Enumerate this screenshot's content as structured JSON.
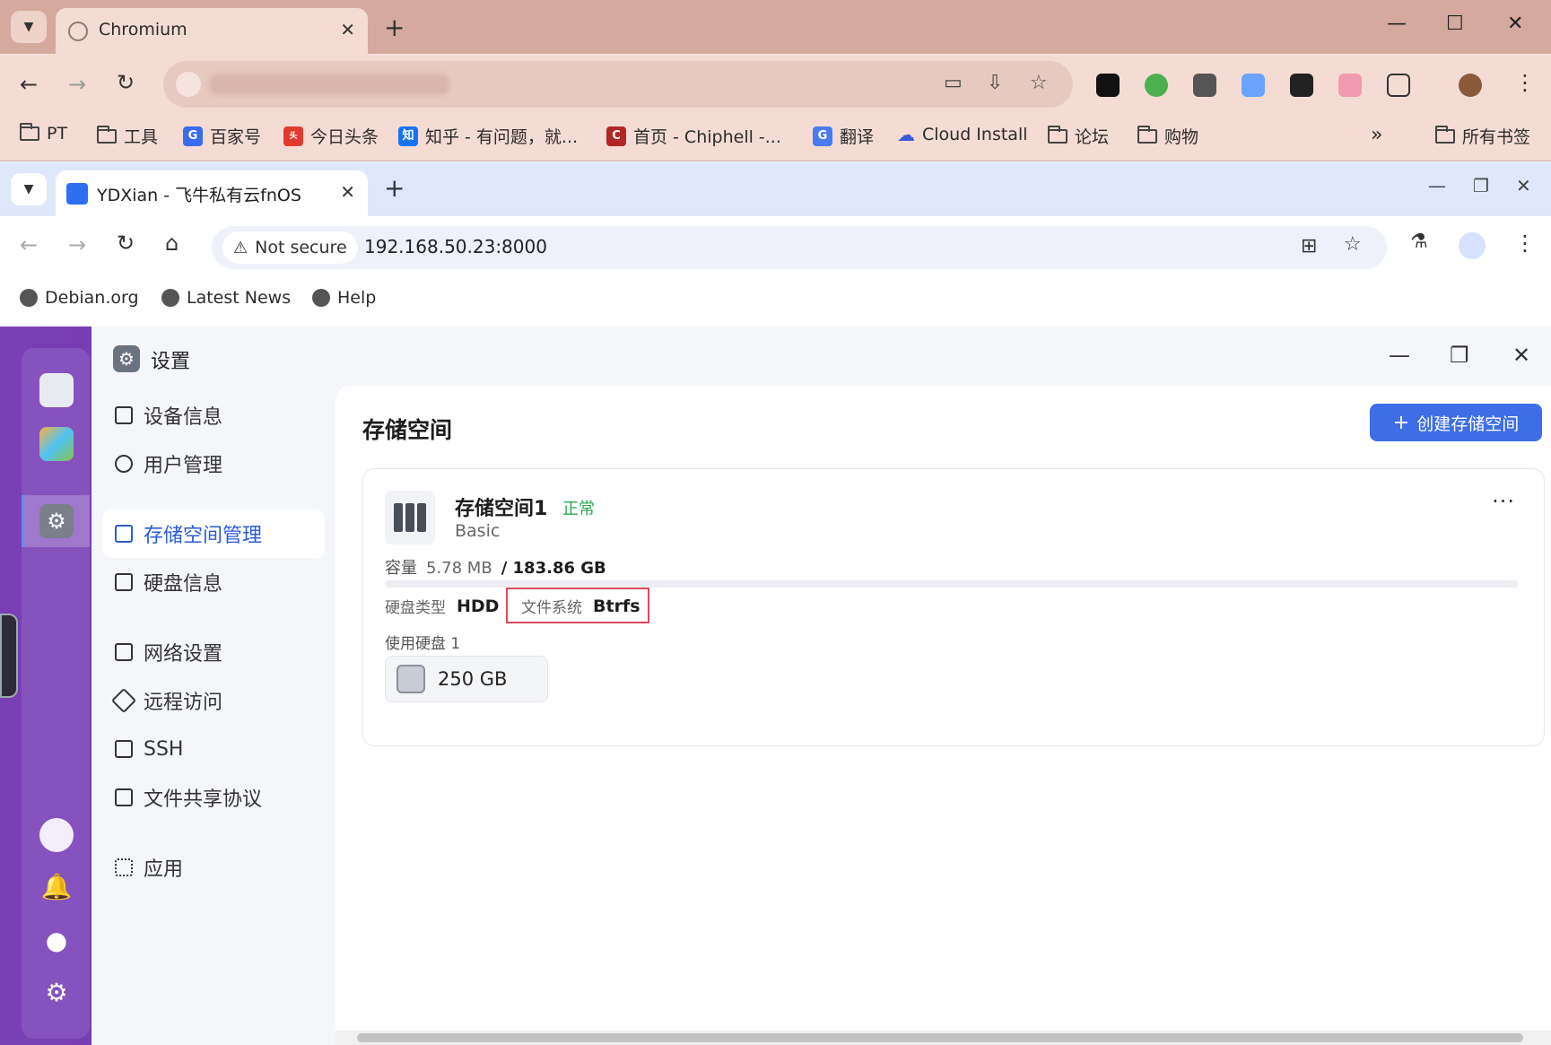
{
  "outer_browser": {
    "tab_title": "Chromium",
    "new_tab": "+",
    "close": "✕",
    "bookmarks": [
      {
        "label": "PT",
        "icon": "folder-icon"
      },
      {
        "label": "工具",
        "icon": "folder-icon"
      },
      {
        "label": "百家号",
        "icon": "baijiahao-icon"
      },
      {
        "label": "今日头条",
        "icon": "toutiao-icon"
      },
      {
        "label": "知乎 - 有问题，就...",
        "icon": "zhihu-icon"
      },
      {
        "label": "首页 - Chiphell -...",
        "icon": "chiphell-icon"
      },
      {
        "label": "翻译",
        "icon": "translate-icon"
      },
      {
        "label": "Cloud Install",
        "icon": "cloud-icon"
      },
      {
        "label": "论坛",
        "icon": "folder-icon"
      },
      {
        "label": "购物",
        "icon": "folder-icon"
      }
    ],
    "overflow": "»",
    "all_bookmarks": "所有书签"
  },
  "inner_browser": {
    "tab_title": "YDXian - 飞牛私有云fnOS",
    "new_tab": "+",
    "close": "✕",
    "security_label": "Not secure",
    "url": "192.168.50.23:8000",
    "bookmarks": [
      {
        "label": "Debian.org"
      },
      {
        "label": "Latest News"
      },
      {
        "label": "Help"
      }
    ]
  },
  "settings": {
    "window_title": "设置",
    "nav": [
      {
        "label": "设备信息",
        "name": "nav-device-info"
      },
      {
        "label": "用户管理",
        "name": "nav-user-management"
      },
      {
        "label": "存储空间管理",
        "name": "nav-storage-management",
        "active": true
      },
      {
        "label": "硬盘信息",
        "name": "nav-disk-info"
      },
      {
        "label": "网络设置",
        "name": "nav-network-settings"
      },
      {
        "label": "远程访问",
        "name": "nav-remote-access"
      },
      {
        "label": "SSH",
        "name": "nav-ssh"
      },
      {
        "label": "文件共享协议",
        "name": "nav-file-sharing"
      },
      {
        "label": "应用",
        "name": "nav-apps"
      }
    ],
    "page_title": "存储空间",
    "create_button": "创建存储空间",
    "pool": {
      "name": "存储空间1",
      "status": "正常",
      "raid": "Basic",
      "capacity_label": "容量",
      "used": "5.78 MB",
      "total": "/ 183.86 GB",
      "usage_fraction": 0.0,
      "disk_type_label": "硬盘类型",
      "disk_type": "HDD",
      "fs_label": "文件系统",
      "fs": "Btrfs",
      "disks_label": "使用硬盘 1",
      "disk_size": "250 GB",
      "more": "···"
    },
    "accent_color": "#3d6ee8",
    "status_color": "#2aa84a"
  }
}
